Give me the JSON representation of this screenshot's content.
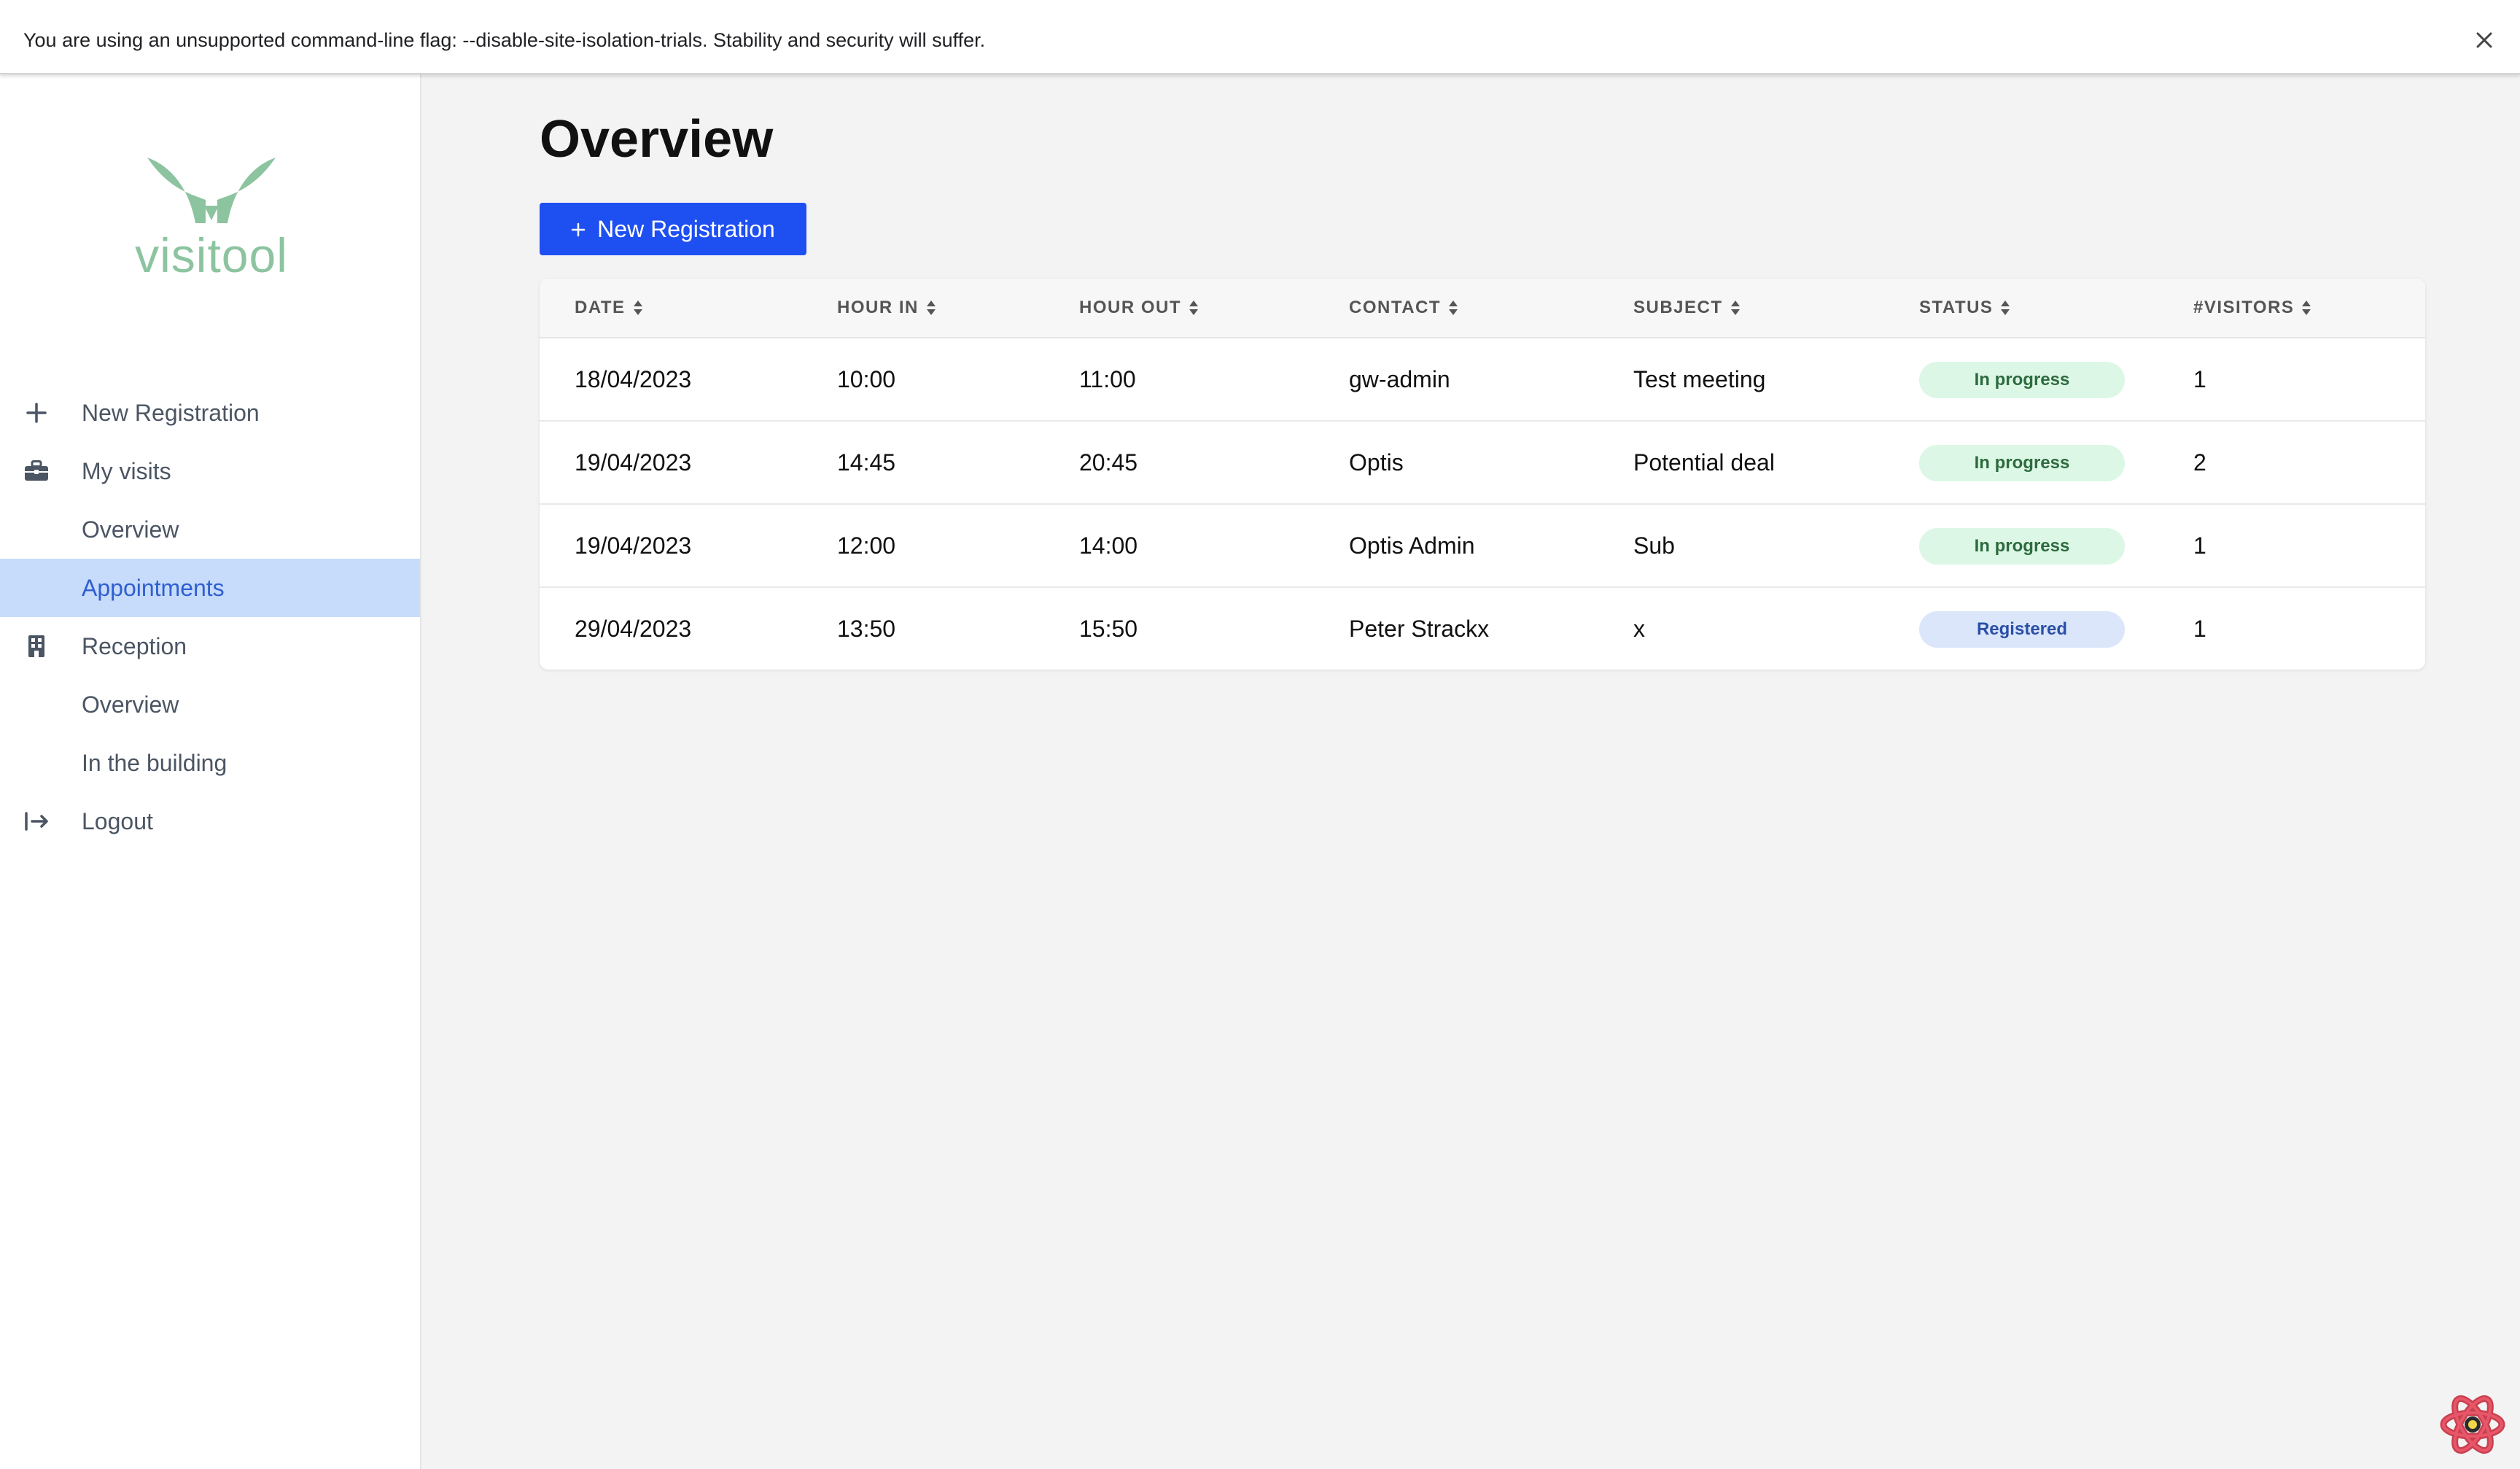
{
  "infobar": {
    "message": "You are using an unsupported command-line flag: --disable-site-isolation-trials. Stability and security will suffer.",
    "close_icon": "close-icon"
  },
  "sidebar": {
    "logo_text": "visitool",
    "logo_color": "#8dc4a0",
    "items": [
      {
        "label": "New Registration",
        "icon": "plus-icon"
      },
      {
        "label": "My visits",
        "icon": "briefcase-icon"
      },
      {
        "label": "Overview"
      },
      {
        "label": "Appointments",
        "active": true
      },
      {
        "label": "Reception",
        "icon": "building-icon"
      },
      {
        "label": "Overview"
      },
      {
        "label": "In the building"
      },
      {
        "label": "Logout",
        "icon": "logout-icon"
      }
    ]
  },
  "main": {
    "title": "Overview",
    "new_button_label": "New Registration",
    "accent_color": "#1e4ff0"
  },
  "table": {
    "columns": [
      "DATE",
      "HOUR IN",
      "HOUR OUT",
      "CONTACT",
      "SUBJECT",
      "STATUS",
      "#VISITORS"
    ],
    "rows": [
      {
        "date": "18/04/2023",
        "hour_in": "10:00",
        "hour_out": "11:00",
        "contact": "gw-admin",
        "subject": "Test meeting",
        "status": "In progress",
        "visitors": "1"
      },
      {
        "date": "19/04/2023",
        "hour_in": "14:45",
        "hour_out": "20:45",
        "contact": "Optis",
        "subject": "Potential deal",
        "status": "In progress",
        "visitors": "2"
      },
      {
        "date": "19/04/2023",
        "hour_in": "12:00",
        "hour_out": "14:00",
        "contact": "Optis Admin",
        "subject": "Sub",
        "status": "In progress",
        "visitors": "1"
      },
      {
        "date": "29/04/2023",
        "hour_in": "13:50",
        "hour_out": "15:50",
        "contact": "Peter Strackx",
        "subject": "x",
        "status": "Registered",
        "visitors": "1"
      }
    ]
  }
}
